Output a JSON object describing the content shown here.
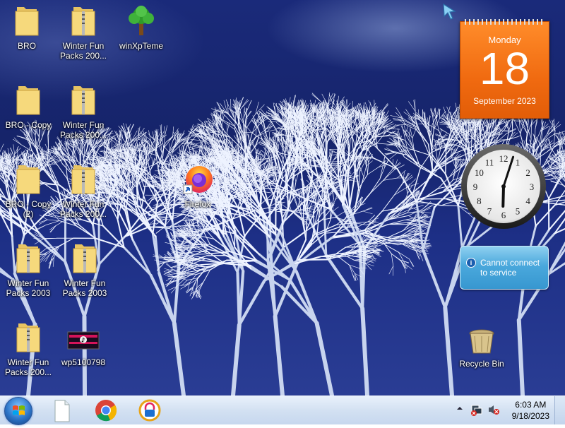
{
  "desktop": {
    "icons": [
      {
        "label": "BRO",
        "type": "folder"
      },
      {
        "label": "Winter Fun Packs 200...",
        "type": "zip-folder"
      },
      {
        "label": "winXpTeme",
        "type": "tree"
      },
      {
        "label": "BRO - Copy",
        "type": "folder"
      },
      {
        "label": "Winter Fun Packs 200...",
        "type": "zip-folder"
      },
      {
        "label": "BRO - Copy (2)",
        "type": "folder"
      },
      {
        "label": "Winter Fun Packs 200...",
        "type": "zip-folder"
      },
      {
        "label": "Firefox",
        "type": "firefox-shortcut"
      },
      {
        "label": "Winter Fun Packs 2003",
        "type": "zip-folder"
      },
      {
        "label": "Winter Fun Packs 2003",
        "type": "zip-folder"
      },
      {
        "label": "Winter Fun Packs 200...",
        "type": "zip-folder"
      },
      {
        "label": "wp5100798",
        "type": "image"
      },
      {
        "label": "Recycle Bin",
        "type": "recycle-bin"
      }
    ]
  },
  "gadgets": {
    "calendar": {
      "day": "Monday",
      "date": "18",
      "month_year": "September 2023"
    },
    "clock": {
      "hour": 6,
      "minute": 3
    },
    "notice": {
      "message": "Cannot connect to service",
      "icon": "info-icon"
    }
  },
  "taskbar": {
    "pinned": [
      {
        "name": "notepad-document",
        "icon": "document-icon"
      },
      {
        "name": "chrome",
        "icon": "chrome-icon"
      },
      {
        "name": "vpn-app",
        "icon": "lock-app-icon"
      }
    ],
    "tray": {
      "icons": [
        "show-hidden-icon",
        "network-icon",
        "volume-muted-icon"
      ],
      "time": "6:03 AM",
      "date": "9/18/2023"
    }
  },
  "colors": {
    "wallpaper_sky": "#1a2a7a",
    "calendar_orange": "#f06a10",
    "notice_blue": "#3797d0",
    "taskbar": "#d3e1f2"
  }
}
